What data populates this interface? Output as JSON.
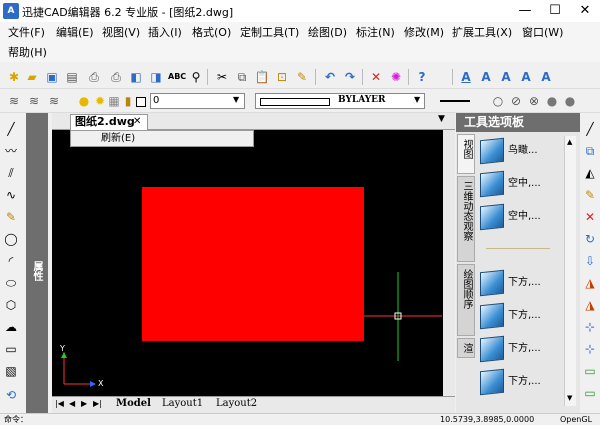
{
  "window": {
    "title": "迅捷CAD编辑器 6.2 专业版 - [图纸2.dwg]",
    "minimize": "—",
    "maximize": "☐",
    "close": "✕"
  },
  "menu": {
    "items": [
      "文件(F)",
      "编辑(E)",
      "视图(V)",
      "插入(I)",
      "格式(O)",
      "定制工具(T)",
      "绘图(D)",
      "标注(N)",
      "修改(M)",
      "扩展工具(X)",
      "窗口(W)"
    ],
    "help": "帮助(H)"
  },
  "layerbar": {
    "layer_name": "0",
    "linetype": "BYLAYER"
  },
  "properties_panel": {
    "label": "属性"
  },
  "document": {
    "tab_label": "图纸2.dwg",
    "tab_close": "✕",
    "context_menu_item": "刷新(E)"
  },
  "ucs": {
    "x": "X",
    "y": "Y"
  },
  "layout_tabs": [
    "Model",
    "Layout1",
    "Layout2"
  ],
  "tool_palette": {
    "header": "工具选项板",
    "tabs": [
      "视图",
      "三维动态观察",
      "绘图顺序",
      "渲"
    ],
    "items": [
      "鸟瞰...",
      "空中,...",
      "空中,...",
      "下方,...",
      "下方,...",
      "下方,...",
      "下方,..."
    ]
  },
  "status": {
    "command": "命令：",
    "coords": "10.5739,3.8985,0.0000",
    "extra": "OpenGL"
  },
  "colors": {
    "accent": "#2d6bc4",
    "canvas": "#000000",
    "rectangle": "#ff0000",
    "crosshair_h": "#ff3333",
    "crosshair_v": "#22cc22"
  }
}
